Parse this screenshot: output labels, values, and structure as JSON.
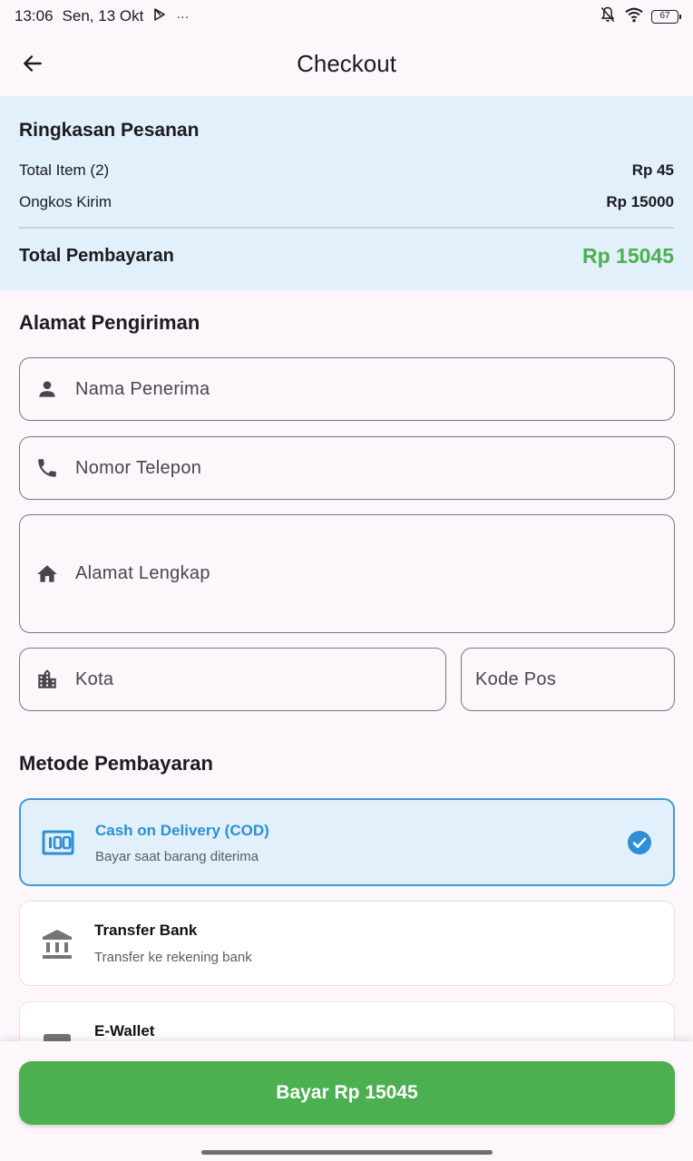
{
  "status_bar": {
    "time": "13:06",
    "date": "Sen, 13 Okt",
    "more": "···",
    "battery": "67"
  },
  "app_bar": {
    "title": "Checkout"
  },
  "summary": {
    "title": "Ringkasan Pesanan",
    "items_label": "Total Item (2)",
    "items_value": "Rp 45",
    "shipping_label": "Ongkos Kirim",
    "shipping_value": "Rp 15000",
    "total_label": "Total Pembayaran",
    "total_value": "Rp 15045",
    "total_color": "#4CAF50"
  },
  "address": {
    "title": "Alamat Pengiriman",
    "name_placeholder": "Nama Penerima",
    "phone_placeholder": "Nomor Telepon",
    "address_placeholder": "Alamat Lengkap",
    "city_placeholder": "Kota",
    "postal_placeholder": "Kode Pos"
  },
  "payment": {
    "title": "Metode Pembayaran",
    "methods": [
      {
        "title": "Cash on Delivery (COD)",
        "subtitle": "Bayar saat barang diterima",
        "icon": "money-icon",
        "selected": true
      },
      {
        "title": "Transfer Bank",
        "subtitle": "Transfer ke rekening bank",
        "icon": "bank-icon",
        "selected": false
      },
      {
        "title": "E-Wallet",
        "subtitle": "",
        "icon": "wallet-icon",
        "selected": false
      }
    ],
    "accent_color": "#2D8FD5"
  },
  "footer": {
    "pay_button": "Bayar Rp 15045",
    "button_color": "#4CAF50"
  }
}
